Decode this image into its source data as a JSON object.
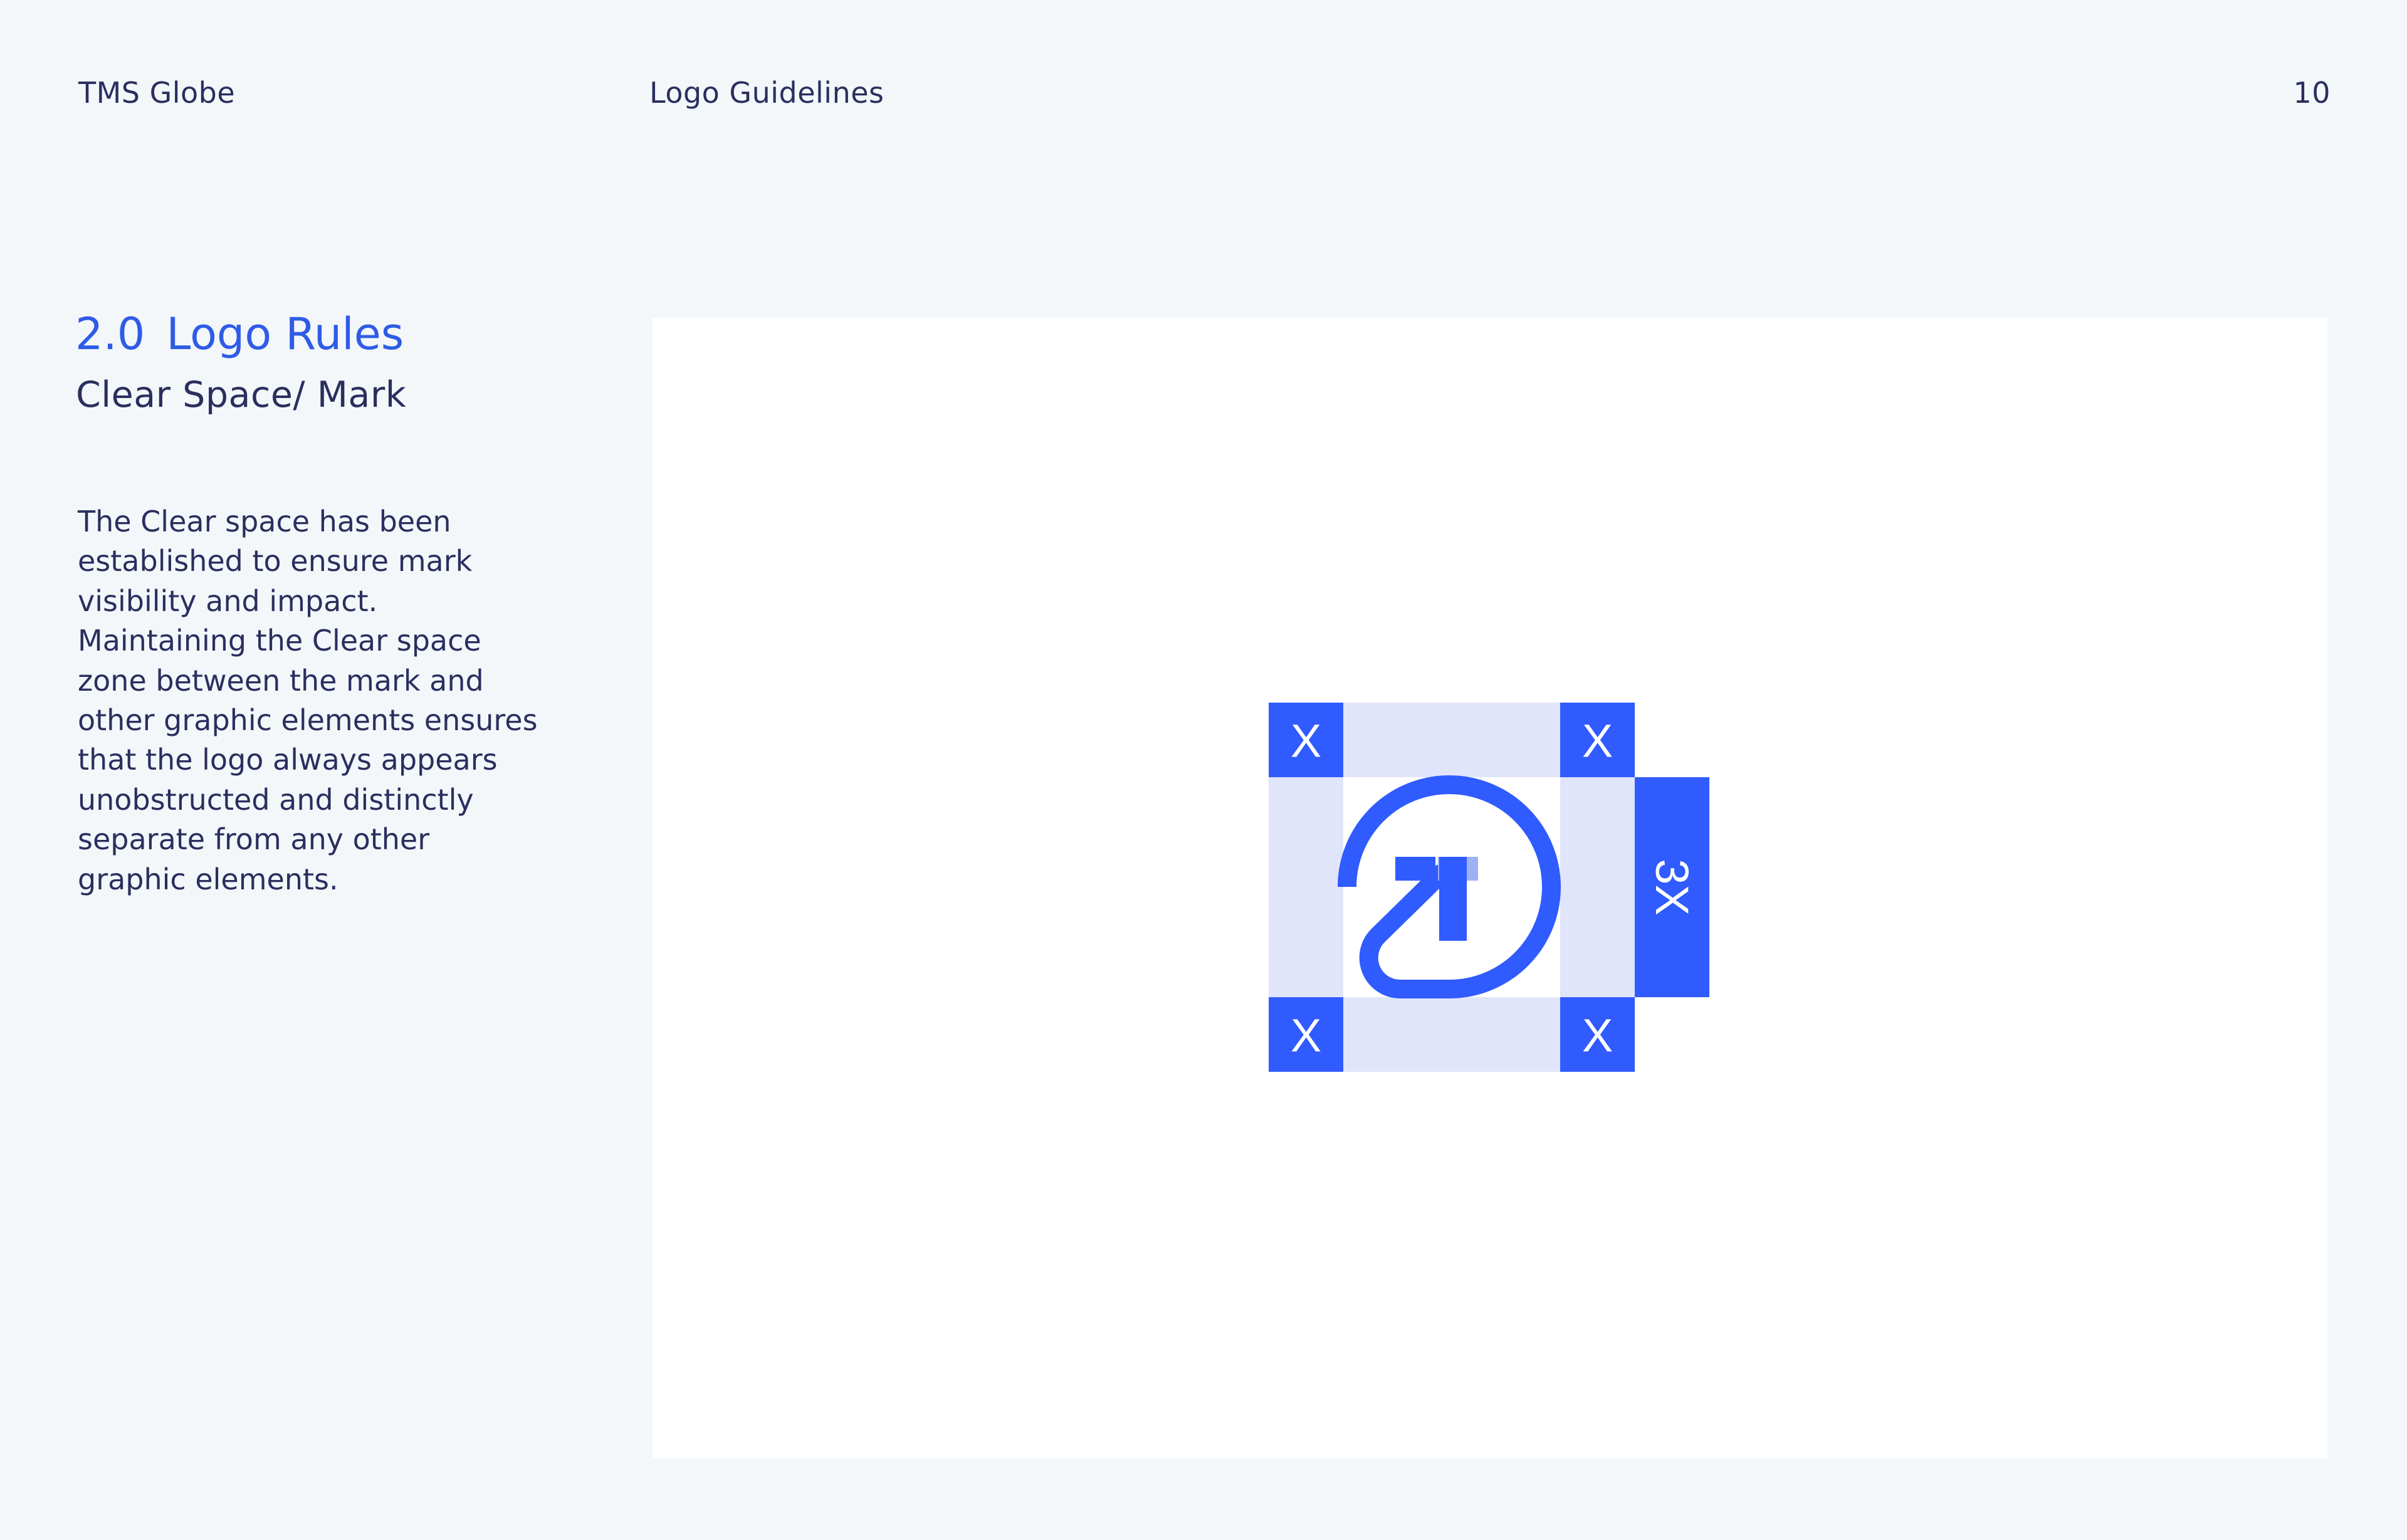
{
  "header": {
    "brand": "TMS Globe",
    "document_title": "Logo Guidelines",
    "page_number": "10"
  },
  "section": {
    "number": "2.0",
    "title": "Logo Rules",
    "subtitle": "Clear Space/ Mark"
  },
  "body_lines": [
    "The Clear space has been",
    "established to ensure mark",
    "visibility and impact.",
    "Maintaining the Clear space",
    "zone between the mark and",
    "other graphic elements ensures",
    "that the logo always appears",
    "unobstructed and distinctly",
    "separate from any other",
    "graphic elements."
  ],
  "diagram": {
    "corner_label": "X",
    "side_label": "3X",
    "colors": {
      "primary": "#2f5bff",
      "zone": "#e0e5fb",
      "accent_light": "#9db0f8",
      "panel": "#ffffff",
      "page": "#f3f7fa",
      "text": "#2b2f5e",
      "heading": "#2f5ce6"
    }
  }
}
